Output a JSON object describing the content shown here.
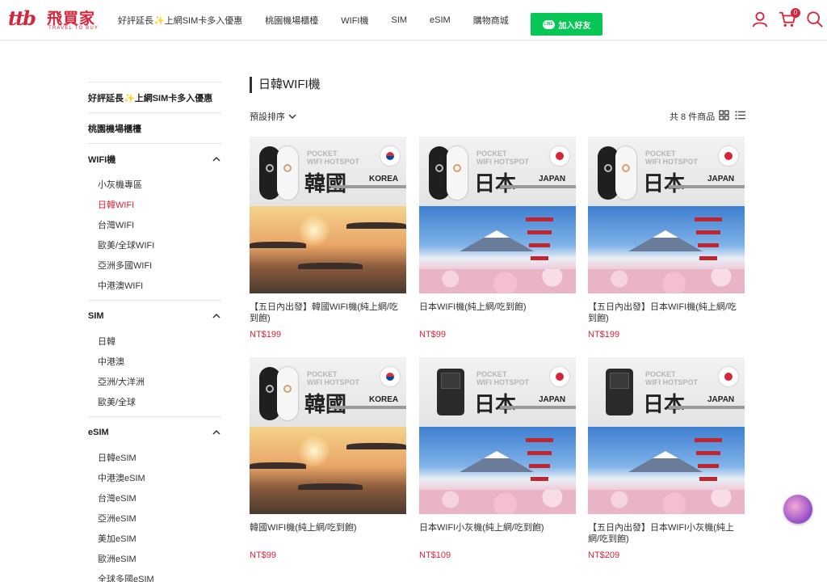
{
  "brand": {
    "mark": "ttb",
    "name_cn": "飛買家",
    "name_en": "TRAVEL TO BUY",
    "color": "#d6243a"
  },
  "nav": {
    "items": [
      "好評延長✨上網SIM卡多入優惠",
      "桃園機場櫃檯",
      "WIFI機",
      "SIM",
      "eSIM",
      "購物商城"
    ],
    "line_button": {
      "icon_text": "LINE",
      "label": "加入好友",
      "color": "#06c755"
    },
    "cart_count": "0"
  },
  "sidebar": {
    "categories": [
      {
        "label": "好評延長✨上網SIM卡多入優惠",
        "expandable": false,
        "subs": []
      },
      {
        "label": "桃園機場櫃檯",
        "expandable": false,
        "subs": []
      },
      {
        "label": "WIFI機",
        "expandable": true,
        "subs": [
          "小灰機專區",
          "日韓WIFI",
          "台灣WIFI",
          "歐美/全球WIFI",
          "亞洲多國WIFI",
          "中港澳WIFI"
        ]
      },
      {
        "label": "SIM",
        "expandable": true,
        "subs": [
          "日韓",
          "中港澳",
          "亞洲/大洋洲",
          "歐美/全球"
        ]
      },
      {
        "label": "eSIM",
        "expandable": true,
        "subs": [
          "日韓eSIM",
          "中港澳eSIM",
          "台灣eSIM",
          "亞洲eSIM",
          "美加eSIM",
          "歐洲eSIM",
          "全球多國eSIM"
        ]
      }
    ],
    "active_sub": "日韓WIFI"
  },
  "main": {
    "title": "日韓WIFI機",
    "sort_label": "預設排序",
    "count_label": "共 8 件商品"
  },
  "products": [
    {
      "name": "【五日內出發】韓國WIFI機(純上網/吃到飽)",
      "price": "NT$199",
      "country_cn": "韓國",
      "country_en": "KOREA",
      "device": "pocket",
      "scene": "korea",
      "flag": "kr",
      "tag_line1": "POCKET",
      "tag_line2": "WIFI HOTSPOT"
    },
    {
      "name": "日本WIFI機(純上網/吃到飽)",
      "price": "NT$99",
      "country_cn": "日本",
      "country_en": "JAPAN",
      "device": "pocket",
      "scene": "japan",
      "flag": "jp",
      "tag_line1": "POCKET",
      "tag_line2": "WIFI HOTSPOT"
    },
    {
      "name": "【五日內出發】日本WIFI機(純上網/吃到飽)",
      "price": "NT$199",
      "country_cn": "日本",
      "country_en": "JAPAN",
      "device": "pocket",
      "scene": "japan",
      "flag": "jp",
      "tag_line1": "POCKET",
      "tag_line2": "WIFI HOTSPOT"
    },
    {
      "name": "韓國WIFI機(純上網/吃到飽)",
      "price": "NT$99",
      "country_cn": "韓國",
      "country_en": "KOREA",
      "device": "pocket",
      "scene": "korea",
      "flag": "kr",
      "tag_line1": "POCKET",
      "tag_line2": "WIFI HOTSPOT"
    },
    {
      "name": "日本WIFI小灰機(純上網/吃到飽)",
      "price": "NT$109",
      "country_cn": "日本",
      "country_en": "JAPAN",
      "device": "router",
      "scene": "japan",
      "flag": "jp",
      "tag_line1": "POCKET",
      "tag_line2": "WIFI HOTSPOT"
    },
    {
      "name": "【五日內出發】日本WIFI小灰機(純上網/吃到飽)",
      "price": "NT$209",
      "country_cn": "日本",
      "country_en": "JAPAN",
      "device": "router",
      "scene": "japan",
      "flag": "jp",
      "tag_line1": "POCKET",
      "tag_line2": "WIFI HOTSPOT"
    }
  ]
}
